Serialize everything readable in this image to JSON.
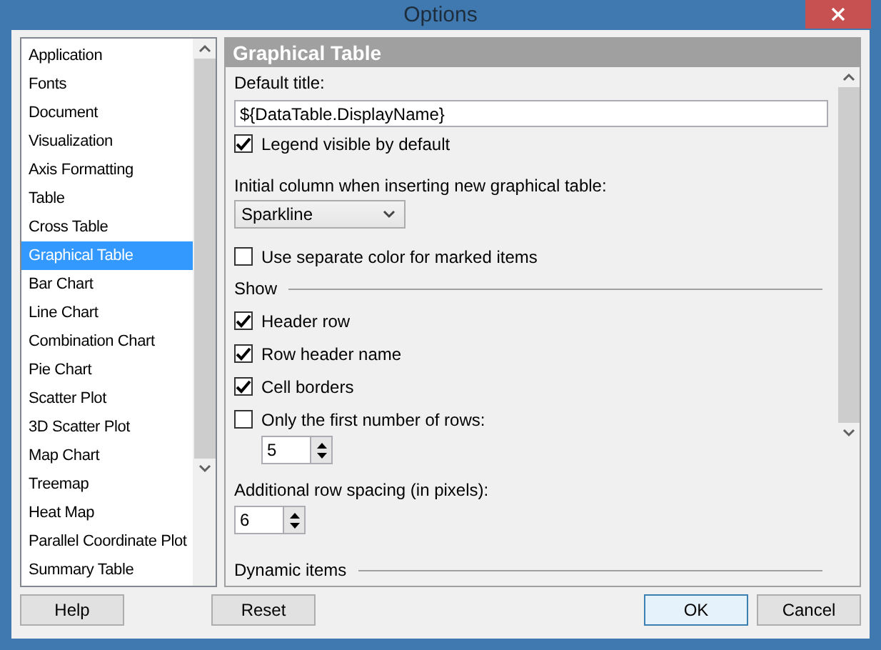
{
  "window": {
    "title": "Options"
  },
  "categories": [
    {
      "label": "Application",
      "selected": false
    },
    {
      "label": "Fonts",
      "selected": false
    },
    {
      "label": "Document",
      "selected": false
    },
    {
      "label": "Visualization",
      "selected": false
    },
    {
      "label": "Axis Formatting",
      "selected": false
    },
    {
      "label": "Table",
      "selected": false
    },
    {
      "label": "Cross Table",
      "selected": false
    },
    {
      "label": "Graphical Table",
      "selected": true
    },
    {
      "label": "Bar Chart",
      "selected": false
    },
    {
      "label": "Line Chart",
      "selected": false
    },
    {
      "label": "Combination Chart",
      "selected": false
    },
    {
      "label": "Pie Chart",
      "selected": false
    },
    {
      "label": "Scatter Plot",
      "selected": false
    },
    {
      "label": "3D Scatter Plot",
      "selected": false
    },
    {
      "label": "Map Chart",
      "selected": false
    },
    {
      "label": "Treemap",
      "selected": false
    },
    {
      "label": "Heat Map",
      "selected": false
    },
    {
      "label": "Parallel Coordinate Plot",
      "selected": false
    },
    {
      "label": "Summary Table",
      "selected": false
    }
  ],
  "panel": {
    "title": "Graphical Table",
    "items": [
      {
        "kind": "label",
        "text": "Default title:"
      },
      {
        "kind": "text",
        "value": "${DataTable.DisplayName}"
      },
      {
        "kind": "checkbox",
        "label": "Legend visible by default",
        "checked": true
      },
      {
        "kind": "label",
        "text": "Initial column when inserting new graphical table:"
      },
      {
        "kind": "dropdown",
        "value": "Sparkline"
      },
      {
        "kind": "checkbox",
        "label": "Use separate color for marked items",
        "checked": false
      },
      {
        "kind": "section",
        "text": "Show"
      },
      {
        "kind": "checkbox",
        "label": "Header row",
        "checked": true
      },
      {
        "kind": "checkbox",
        "label": "Row header name",
        "checked": true
      },
      {
        "kind": "checkbox",
        "label": "Cell borders",
        "checked": true
      },
      {
        "kind": "checkbox",
        "label": "Only the first number of rows:",
        "checked": false,
        "spinner": "5"
      },
      {
        "kind": "label",
        "text": "Additional row spacing (in pixels):"
      },
      {
        "kind": "spinner",
        "value": "6"
      },
      {
        "kind": "section",
        "text": "Dynamic items"
      }
    ]
  },
  "buttons": [
    {
      "label": "Help",
      "default": false
    },
    {
      "label": "Reset",
      "default": false
    },
    {
      "label": "OK",
      "default": true
    },
    {
      "label": "Cancel",
      "default": false
    }
  ]
}
